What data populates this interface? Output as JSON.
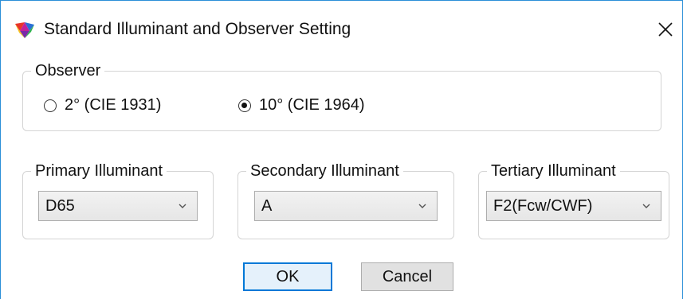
{
  "window": {
    "title": "Standard Illuminant and Observer Setting",
    "accent_color": "#2b8fd8"
  },
  "observer": {
    "legend": "Observer",
    "options": [
      {
        "label": "2° (CIE 1931)",
        "checked": false
      },
      {
        "label": "10° (CIE 1964)",
        "checked": true
      }
    ]
  },
  "illuminants": {
    "primary": {
      "legend": "Primary Illuminant",
      "value": "D65"
    },
    "secondary": {
      "legend": "Secondary Illuminant",
      "value": "A"
    },
    "tertiary": {
      "legend": "Tertiary Illuminant",
      "value": "F2(Fcw/CWF)"
    }
  },
  "buttons": {
    "ok_label": "OK",
    "cancel_label": "Cancel"
  },
  "icons": {
    "app": "color-triangle-icon",
    "close": "close-icon",
    "dropdown": "chevron-down-icon"
  }
}
